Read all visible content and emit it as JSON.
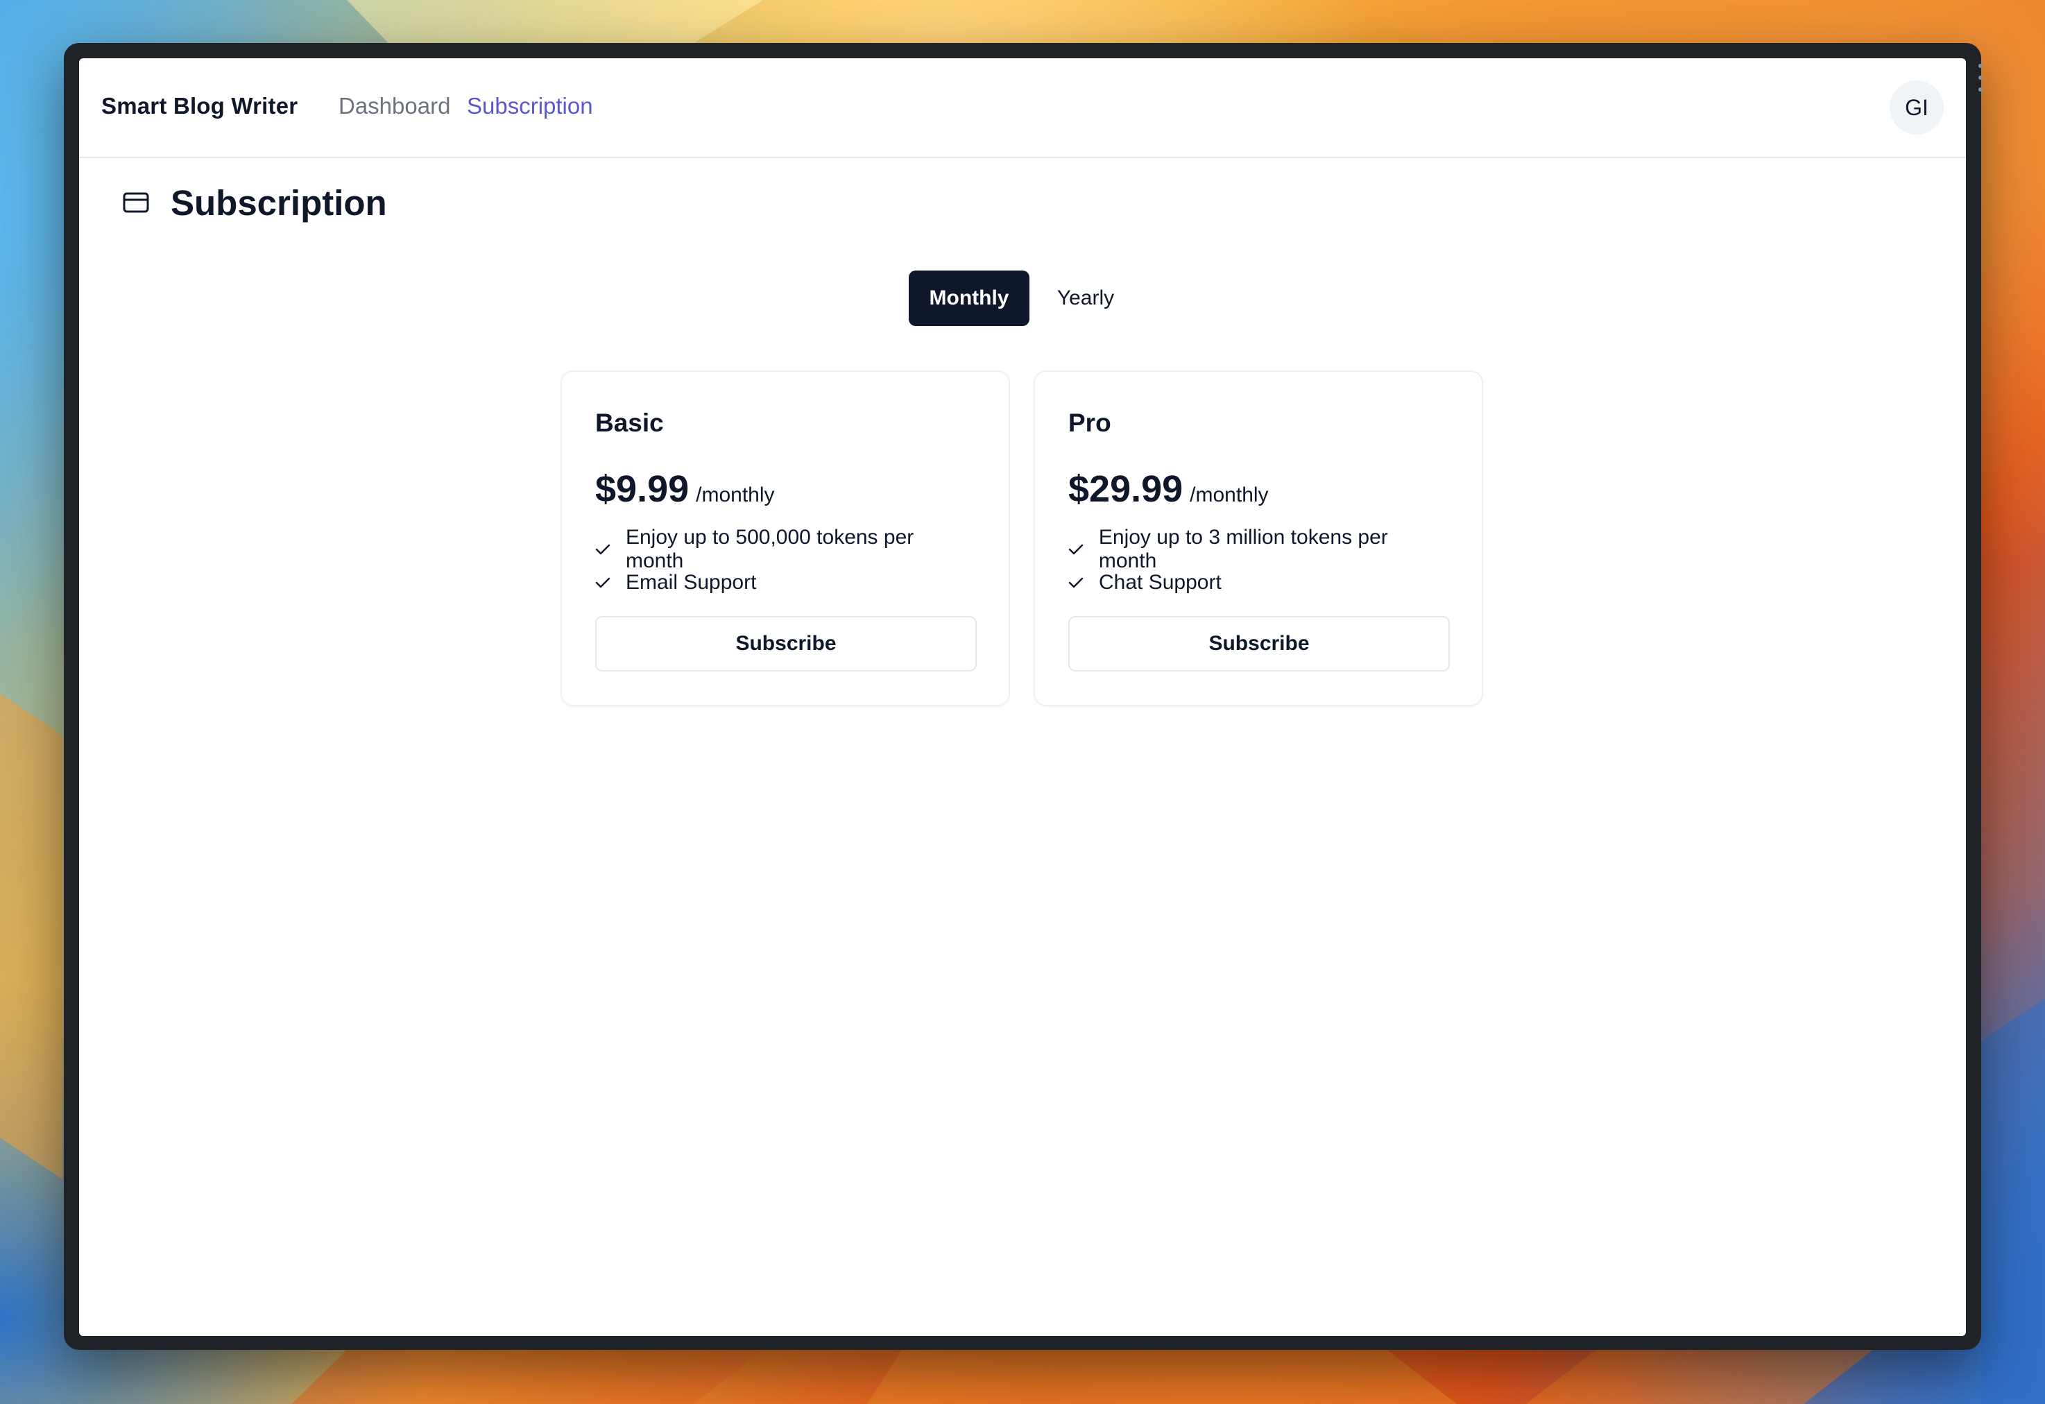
{
  "app": {
    "brand": "Smart Blog Writer",
    "nav": [
      {
        "label": "Dashboard",
        "active": false
      },
      {
        "label": "Subscription",
        "active": true
      }
    ],
    "avatar_initials": "GI"
  },
  "page": {
    "title": "Subscription",
    "icon": "credit-card-icon"
  },
  "billing_toggle": {
    "options": [
      "Monthly",
      "Yearly"
    ],
    "selected": "Monthly"
  },
  "plans": [
    {
      "name": "Basic",
      "price": "$9.99",
      "period": "/monthly",
      "features": [
        "Enjoy up to 500,000 tokens per month",
        "Email Support"
      ],
      "button": "Subscribe"
    },
    {
      "name": "Pro",
      "price": "$29.99",
      "period": "/monthly",
      "features": [
        "Enjoy up to 3 million tokens per month",
        "Chat Support"
      ],
      "button": "Subscribe"
    }
  ],
  "colors": {
    "accent": "#5b57d1",
    "primary_dark": "#0f172a",
    "muted_text": "#6b7280",
    "border": "#e3e6ea"
  }
}
